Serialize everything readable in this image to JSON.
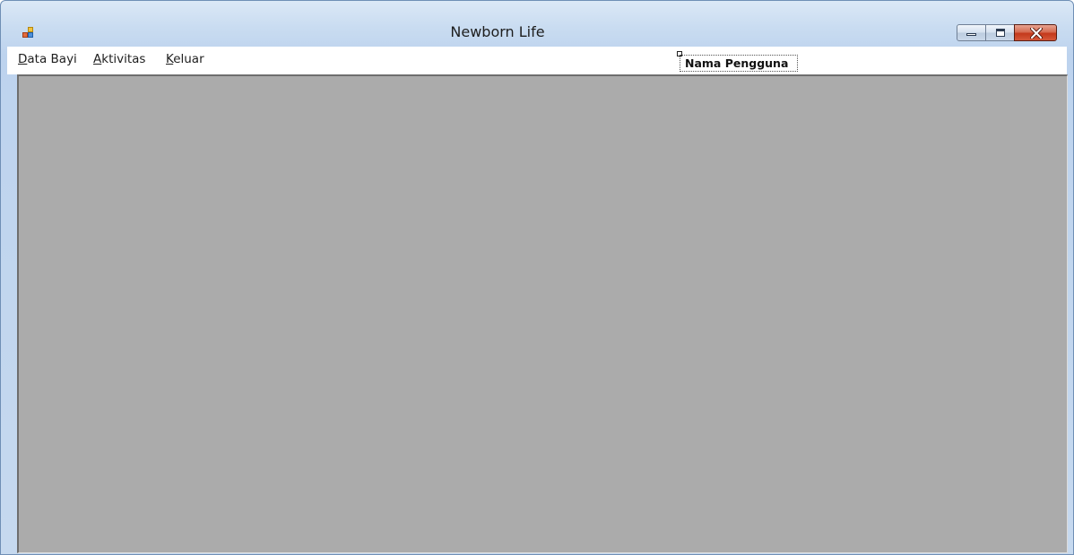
{
  "window": {
    "title": "Newborn Life",
    "controls": {
      "minimize_icon": "minimize-icon",
      "maximize_icon": "maximize-icon",
      "close_icon": "close-icon"
    }
  },
  "menu": {
    "items": [
      {
        "label": "Data Bayi",
        "hotkey": "D",
        "rest": "ata Bayi"
      },
      {
        "label": "Aktivitas",
        "hotkey": "A",
        "rest": "ktivitas"
      },
      {
        "label": "Keluar",
        "hotkey": "K",
        "rest": "eluar"
      }
    ]
  },
  "user_label": {
    "text": "Nama Pengguna"
  },
  "colors": {
    "mdi_background": "#ababab",
    "title_bar": "#c9dcf1",
    "close_button": "#c4391c"
  }
}
